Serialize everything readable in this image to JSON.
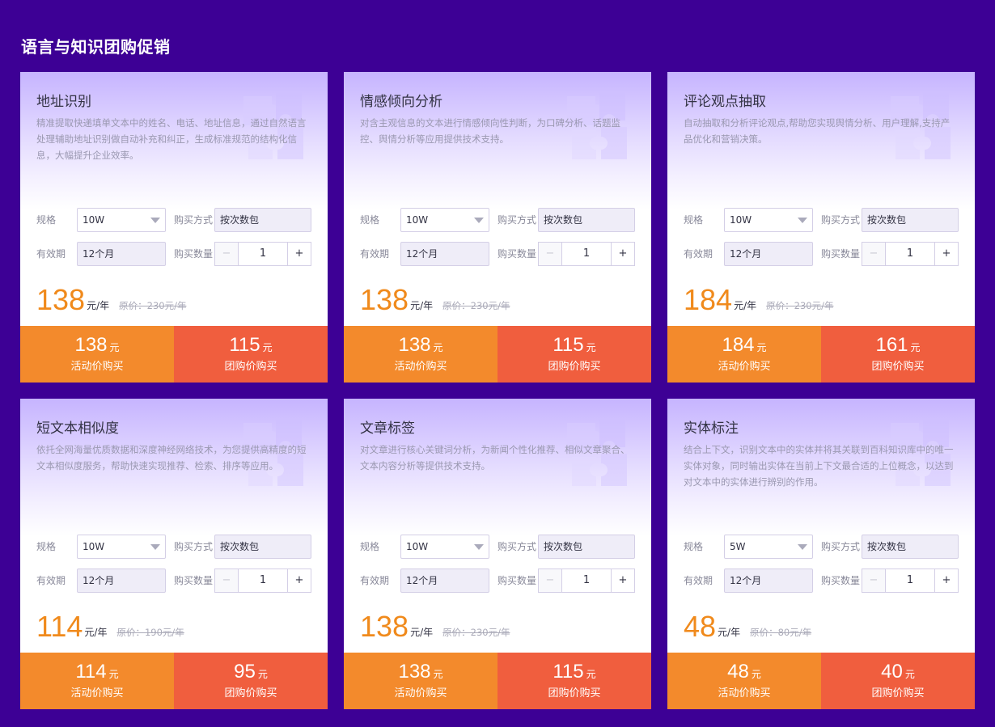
{
  "section_title": "语言与知识团购促销",
  "labels": {
    "spec": "规格",
    "validity": "有效期",
    "method": "购买方式",
    "quantity": "购买数量",
    "minus": "−",
    "plus": "+",
    "activity_buy": "活动价购买",
    "group_buy": "团购价购买"
  },
  "cards": [
    {
      "title": "地址识别",
      "desc": "精准提取快递填单文本中的姓名、电话、地址信息，通过自然语言处理辅助地址识别做自动补充和纠正，生成标准规范的结构化信息，大幅提升企业效率。",
      "spec": "10W",
      "validity": "12个月",
      "method": "按次数包",
      "quantity": "1",
      "price": "138",
      "unit": "元/年",
      "original": "原价：230元/年",
      "activity_price": "138",
      "activity_unit": "元",
      "group_price": "115",
      "group_unit": "元"
    },
    {
      "title": "情感倾向分析",
      "desc": "对含主观信息的文本进行情感倾向性判断，为口碑分析、话题监控、舆情分析等应用提供技术支持。",
      "spec": "10W",
      "validity": "12个月",
      "method": "按次数包",
      "quantity": "1",
      "price": "138",
      "unit": "元/年",
      "original": "原价：230元/年",
      "activity_price": "138",
      "activity_unit": "元",
      "group_price": "115",
      "group_unit": "元"
    },
    {
      "title": "评论观点抽取",
      "desc": "自动抽取和分析评论观点,帮助您实现舆情分析、用户理解,支持产品优化和营销决策。",
      "spec": "10W",
      "validity": "12个月",
      "method": "按次数包",
      "quantity": "1",
      "price": "184",
      "unit": "元/年",
      "original": "原价：230元/年",
      "activity_price": "184",
      "activity_unit": "元",
      "group_price": "161",
      "group_unit": "元"
    },
    {
      "title": "短文本相似度",
      "desc": "依托全网海量优质数据和深度神经网络技术，为您提供高精度的短文本相似度服务，帮助快速实现推荐、检索、排序等应用。",
      "spec": "10W",
      "validity": "12个月",
      "method": "按次数包",
      "quantity": "1",
      "price": "114",
      "unit": "元/年",
      "original": "原价：190元/年",
      "activity_price": "114",
      "activity_unit": "元",
      "group_price": "95",
      "group_unit": "元"
    },
    {
      "title": "文章标签",
      "desc": "对文章进行核心关键词分析，为新闻个性化推荐、相似文章聚合、文本内容分析等提供技术支持。",
      "spec": "10W",
      "validity": "12个月",
      "method": "按次数包",
      "quantity": "1",
      "price": "138",
      "unit": "元/年",
      "original": "原价：230元/年",
      "activity_price": "138",
      "activity_unit": "元",
      "group_price": "115",
      "group_unit": "元"
    },
    {
      "title": "实体标注",
      "desc": "结合上下文，识别文本中的实体并将其关联到百科知识库中的唯一实体对象，同时输出实体在当前上下文最合适的上位概念，以达到对文本中的实体进行辨别的作用。",
      "spec": "5W",
      "validity": "12个月",
      "method": "按次数包",
      "quantity": "1",
      "price": "48",
      "unit": "元/年",
      "original": "原价：80元/年",
      "activity_price": "48",
      "activity_unit": "元",
      "group_price": "40",
      "group_unit": "元"
    }
  ]
}
